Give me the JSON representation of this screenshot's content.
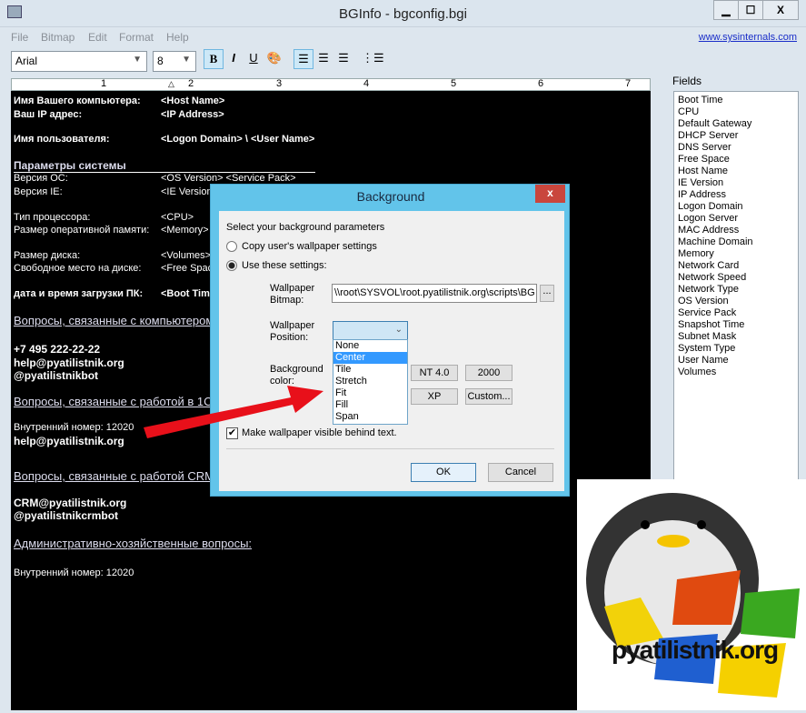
{
  "window": {
    "title": "BGInfo - bgconfig.bgi",
    "min": "▁",
    "max": "☐",
    "close": "X"
  },
  "menu": [
    "File",
    "Bitmap",
    "Edit",
    "Format",
    "Help"
  ],
  "link": "www.sysinternals.com",
  "toolbar": {
    "font": "Arial",
    "size": "8",
    "bold": "B",
    "italic": "I",
    "underline": "U"
  },
  "ruler": [
    "1",
    "2",
    "3",
    "4",
    "5",
    "6",
    "7"
  ],
  "editor": [
    {
      "l": "Имя Вашего компьютера:",
      "v": "<Host Name>",
      "b": true
    },
    {
      "l": "Ваш IP адрес:",
      "v": "<IP Address>",
      "b": true
    },
    {
      "l": "Имя пользователя:",
      "v": "<Logon Domain> \\ <User Name>",
      "b": true
    },
    {
      "h": "Параметры системы"
    },
    {
      "l": "Версия ОС:",
      "v": "<OS Version> <Service Pack>"
    },
    {
      "l": "Версия IE:",
      "v": "<IE Version>"
    },
    {
      "l": "Тип процессора:",
      "v": "<CPU>"
    },
    {
      "l": "Размер оперативной памяти:",
      "v": "<Memory>"
    },
    {
      "l": "Размер диска:",
      "v": "<Volumes>"
    },
    {
      "l": "Свободное место на диске:",
      "v": "<Free Space>"
    },
    {
      "l": "дата и время загрузки ПК:",
      "v": "<Boot Time>",
      "b": true
    },
    {
      "h": "Вопросы, связанные с компьютером"
    },
    {
      "l": "+7 495 222-22-22",
      "b": true
    },
    {
      "l": "help@pyatilistnik.org",
      "b": true
    },
    {
      "l": "@pyatilistnikbot",
      "b": true
    },
    {
      "h": "Вопросы, связанные с работой в 1С"
    },
    {
      "l": "Внутренний номер: 12020"
    },
    {
      "l": "help@pyatilistnik.org",
      "b": true
    },
    {
      "h": "Вопросы, связанные с работой CRM"
    },
    {
      "l": "CRM@pyatilistnik.org",
      "b": true
    },
    {
      "l": "@pyatilistnikcrmbot",
      "b": true
    },
    {
      "h": "Административно-хозяйственные вопросы:"
    },
    {
      "l": "Внутренний номер: 12020"
    }
  ],
  "fields": {
    "label": "Fields",
    "items": [
      "Boot Time",
      "CPU",
      "Default Gateway",
      "DHCP Server",
      "DNS Server",
      "Free Space",
      "Host Name",
      "IE Version",
      "IP Address",
      "Logon Domain",
      "Logon Server",
      "MAC Address",
      "Machine Domain",
      "Memory",
      "Network Card",
      "Network Speed",
      "Network Type",
      "OS Version",
      "Service Pack",
      "Snapshot Time",
      "Subnet Mask",
      "System Type",
      "User Name",
      "Volumes"
    ]
  },
  "dialog": {
    "title": "Background",
    "close": "x",
    "prompt": "Select your background parameters",
    "opt1": "Copy user's wallpaper settings",
    "opt2": "Use these settings:",
    "bitmap_label1": "Wallpaper",
    "bitmap_label2": "Bitmap:",
    "bitmap_value": "\\\\root\\SYSVOL\\root.pyatilistnik.org\\scripts\\BG",
    "browse": "...",
    "pos_label1": "Wallpaper",
    "pos_label2": "Position:",
    "positions": [
      "None",
      "Center",
      "Tile",
      "Stretch",
      "Fit",
      "Fill",
      "Span"
    ],
    "highlighted": "Center",
    "color_label1": "Background",
    "color_label2": "color:",
    "nt4": "NT 4.0",
    "w2000": "2000",
    "xp": "XP",
    "custom": "Custom...",
    "visible": "Make wallpaper visible behind text.",
    "ok": "OK",
    "cancel": "Cancel"
  },
  "logo": {
    "text": "pyatilistnik.org"
  }
}
